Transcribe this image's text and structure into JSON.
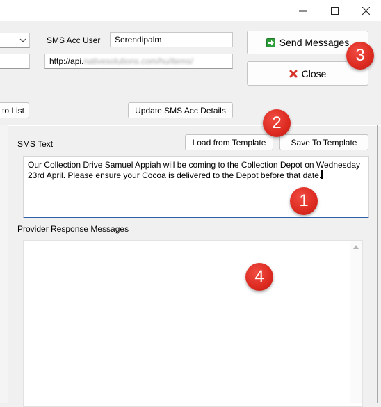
{
  "window": {
    "minimize_icon": "minimize-icon",
    "maximize_icon": "maximize-icon",
    "close_icon": "close-icon"
  },
  "top_panel": {
    "sms_acc_user_label": "SMS Acc User",
    "sms_acc_user_value": "Serendipalm",
    "api_url_prefix": "http://api.",
    "api_url_blurred": "nativesolutions.com/hu/items/",
    "to_list_button": "to List",
    "update_button": "Update SMS Acc Details",
    "send_button": "Send Messages",
    "close_button": "Close"
  },
  "sms_panel": {
    "sms_text_label": "SMS Text",
    "load_template_button": "Load from Template",
    "save_template_button": "Save To Template",
    "sms_text": "Our Collection Drive Samuel Appiah will be coming to the Collection Depot on Wednesday 23rd April. Please ensure your Cocoa is delivered to the Depot before that date.",
    "response_label": "Provider Response Messages"
  },
  "annotations": [
    "1",
    "2",
    "3",
    "4"
  ],
  "colors": {
    "badge": "#dc2a20",
    "focus_border": "#2a5fa8",
    "send_icon": "#2e9e3a",
    "close_icon": "#d6322a"
  }
}
